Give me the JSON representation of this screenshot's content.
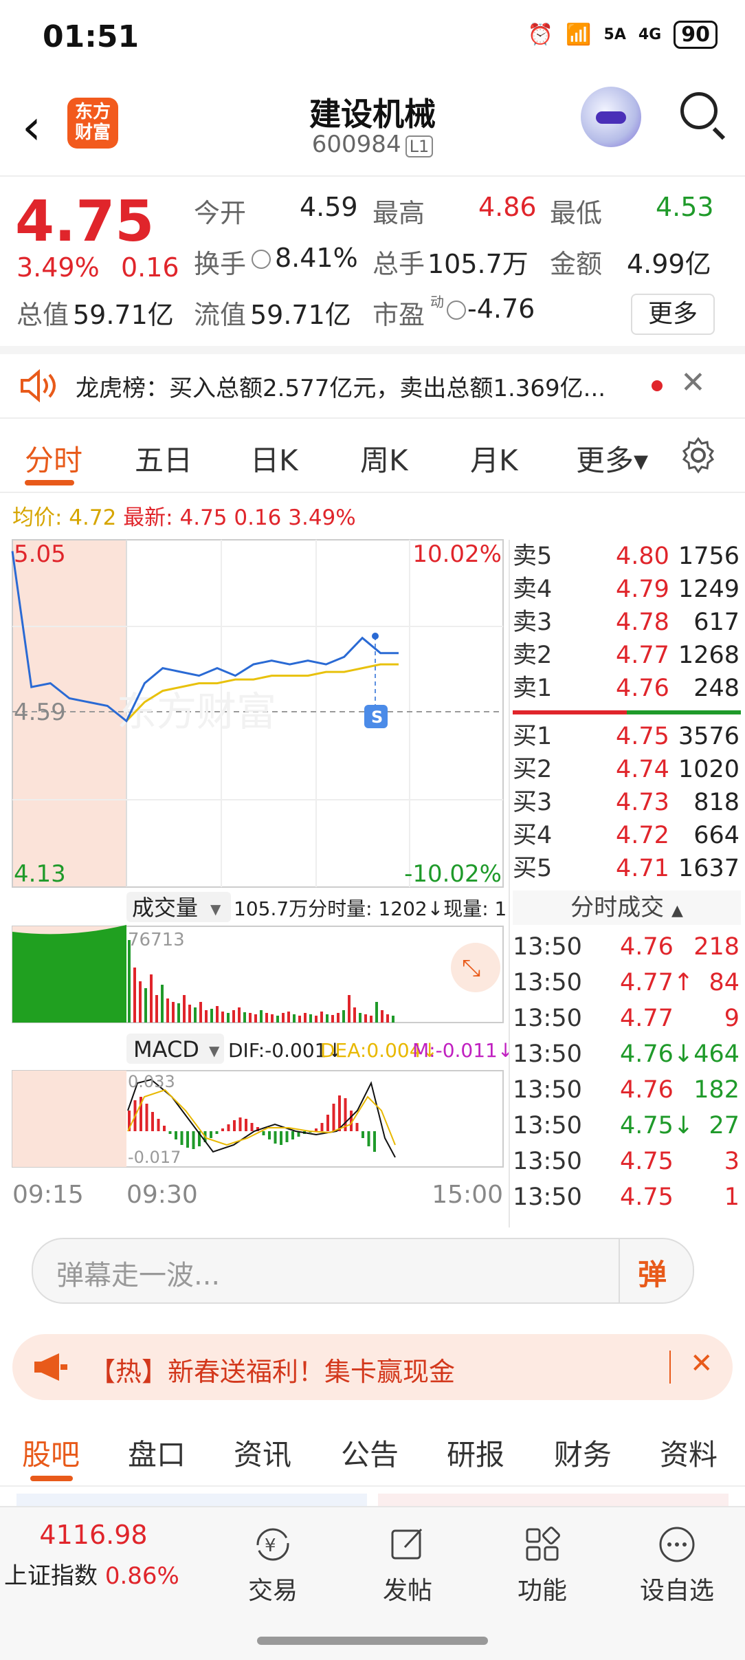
{
  "status_bar": {
    "time": "01:51",
    "network1": "5A",
    "network2": "4G",
    "battery": "90"
  },
  "header": {
    "logo_text_1": "东方",
    "logo_text_2": "财富",
    "title": "建设机械",
    "code": "600984",
    "level": "L1"
  },
  "quote": {
    "price": "4.75",
    "change_pct": "3.49%",
    "change": "0.16",
    "open_label": "今开",
    "open": "4.59",
    "high_label": "最高",
    "high": "4.86",
    "low_label": "最低",
    "low": "4.53",
    "turnover_label": "换手",
    "turnover": "8.41%",
    "volume_label": "总手",
    "volume": "105.7万",
    "amount_label": "金额",
    "amount": "4.99亿",
    "total_cap_label": "总值",
    "total_cap": "59.71亿",
    "float_cap_label": "流值",
    "float_cap": "59.71亿",
    "pe_label": "市盈",
    "pe_sup": "动",
    "pe": "-4.76",
    "more": "更多"
  },
  "notice": {
    "text": "龙虎榜：买入总额2.577亿元，卖出总额1.369亿..."
  },
  "tabs": [
    "分时",
    "五日",
    "日K",
    "周K",
    "月K",
    "更多▾"
  ],
  "chart_info": {
    "avg_label": "均价: 4.72",
    "latest_label": "最新: 4.75 0.16 3.49%",
    "price_top": "5.05",
    "price_base": "4.59",
    "price_bottom": "4.13",
    "pct_top": "10.02%",
    "pct_bottom": "-10.02%",
    "watermark": "东方财富",
    "badge": "S",
    "vol_label": "成交量",
    "vol_info": "105.7万分时量: 1202↓现量: 1",
    "vol_max": "76713",
    "macd_label": "MACD",
    "dif": "DIF:-0.001↓",
    "dea": "DEA:0.004↓",
    "m": "M:-0.011↓",
    "macd_top": "0.033",
    "macd_bottom": "-0.017",
    "t_start": "09:15",
    "t_open": "09:30",
    "t_end": "15:00"
  },
  "chart_data": {
    "type": "line",
    "x_range": [
      "09:15",
      "15:00"
    ],
    "ylim": [
      4.13,
      5.05
    ],
    "y_ref": 4.59,
    "series": [
      {
        "name": "最新",
        "values": [
          5.02,
          4.66,
          4.67,
          4.63,
          4.62,
          4.61,
          4.57,
          4.67,
          4.71,
          4.7,
          4.69,
          4.71,
          4.69,
          4.72,
          4.73,
          4.72,
          4.73,
          4.72,
          4.74,
          4.79,
          4.75,
          4.75
        ]
      },
      {
        "name": "均价",
        "values": [
          null,
          null,
          null,
          null,
          null,
          null,
          4.57,
          4.62,
          4.65,
          4.66,
          4.67,
          4.67,
          4.68,
          4.68,
          4.69,
          4.69,
          4.69,
          4.7,
          4.7,
          4.71,
          4.72,
          4.72
        ]
      }
    ]
  },
  "orderbook": {
    "asks": [
      {
        "label": "卖5",
        "price": "4.80",
        "vol": "1756"
      },
      {
        "label": "卖4",
        "price": "4.79",
        "vol": "1249"
      },
      {
        "label": "卖3",
        "price": "4.78",
        "vol": "617"
      },
      {
        "label": "卖2",
        "price": "4.77",
        "vol": "1268"
      },
      {
        "label": "卖1",
        "price": "4.76",
        "vol": "248"
      }
    ],
    "bids": [
      {
        "label": "买1",
        "price": "4.75",
        "vol": "3576"
      },
      {
        "label": "买2",
        "price": "4.74",
        "vol": "1020"
      },
      {
        "label": "买3",
        "price": "4.73",
        "vol": "818"
      },
      {
        "label": "买4",
        "price": "4.72",
        "vol": "664"
      },
      {
        "label": "买5",
        "price": "4.71",
        "vol": "1637"
      }
    ],
    "ticks_title": "分时成交",
    "ticks": [
      {
        "time": "13:50",
        "price": "4.76",
        "vol": "218",
        "dir": "up"
      },
      {
        "time": "13:50",
        "price": "4.77↑",
        "vol": "84",
        "dir": "up"
      },
      {
        "time": "13:50",
        "price": "4.77",
        "vol": "9",
        "dir": "up"
      },
      {
        "time": "13:50",
        "price": "4.76↓",
        "vol": "464",
        "dir": "down"
      },
      {
        "time": "13:50",
        "price": "4.76",
        "vol": "182",
        "dir": "down"
      },
      {
        "time": "13:50",
        "price": "4.75↓",
        "vol": "27",
        "dir": "down"
      },
      {
        "time": "13:50",
        "price": "4.75",
        "vol": "3",
        "dir": "up"
      },
      {
        "time": "13:50",
        "price": "4.75",
        "vol": "1",
        "dir": "up"
      }
    ]
  },
  "comment": {
    "placeholder": "弹幕走一波...",
    "button": "弹"
  },
  "promo": {
    "text": "【热】新春送福利！集卡赢现金"
  },
  "bottom_tabs": [
    "股吧",
    "盘口",
    "资讯",
    "公告",
    "研报",
    "财务",
    "资料"
  ],
  "nav": {
    "index_value": "4116.98",
    "index_name": "上证指数",
    "index_pct": "0.86%",
    "items": [
      "交易",
      "发帖",
      "功能",
      "设自选"
    ]
  }
}
